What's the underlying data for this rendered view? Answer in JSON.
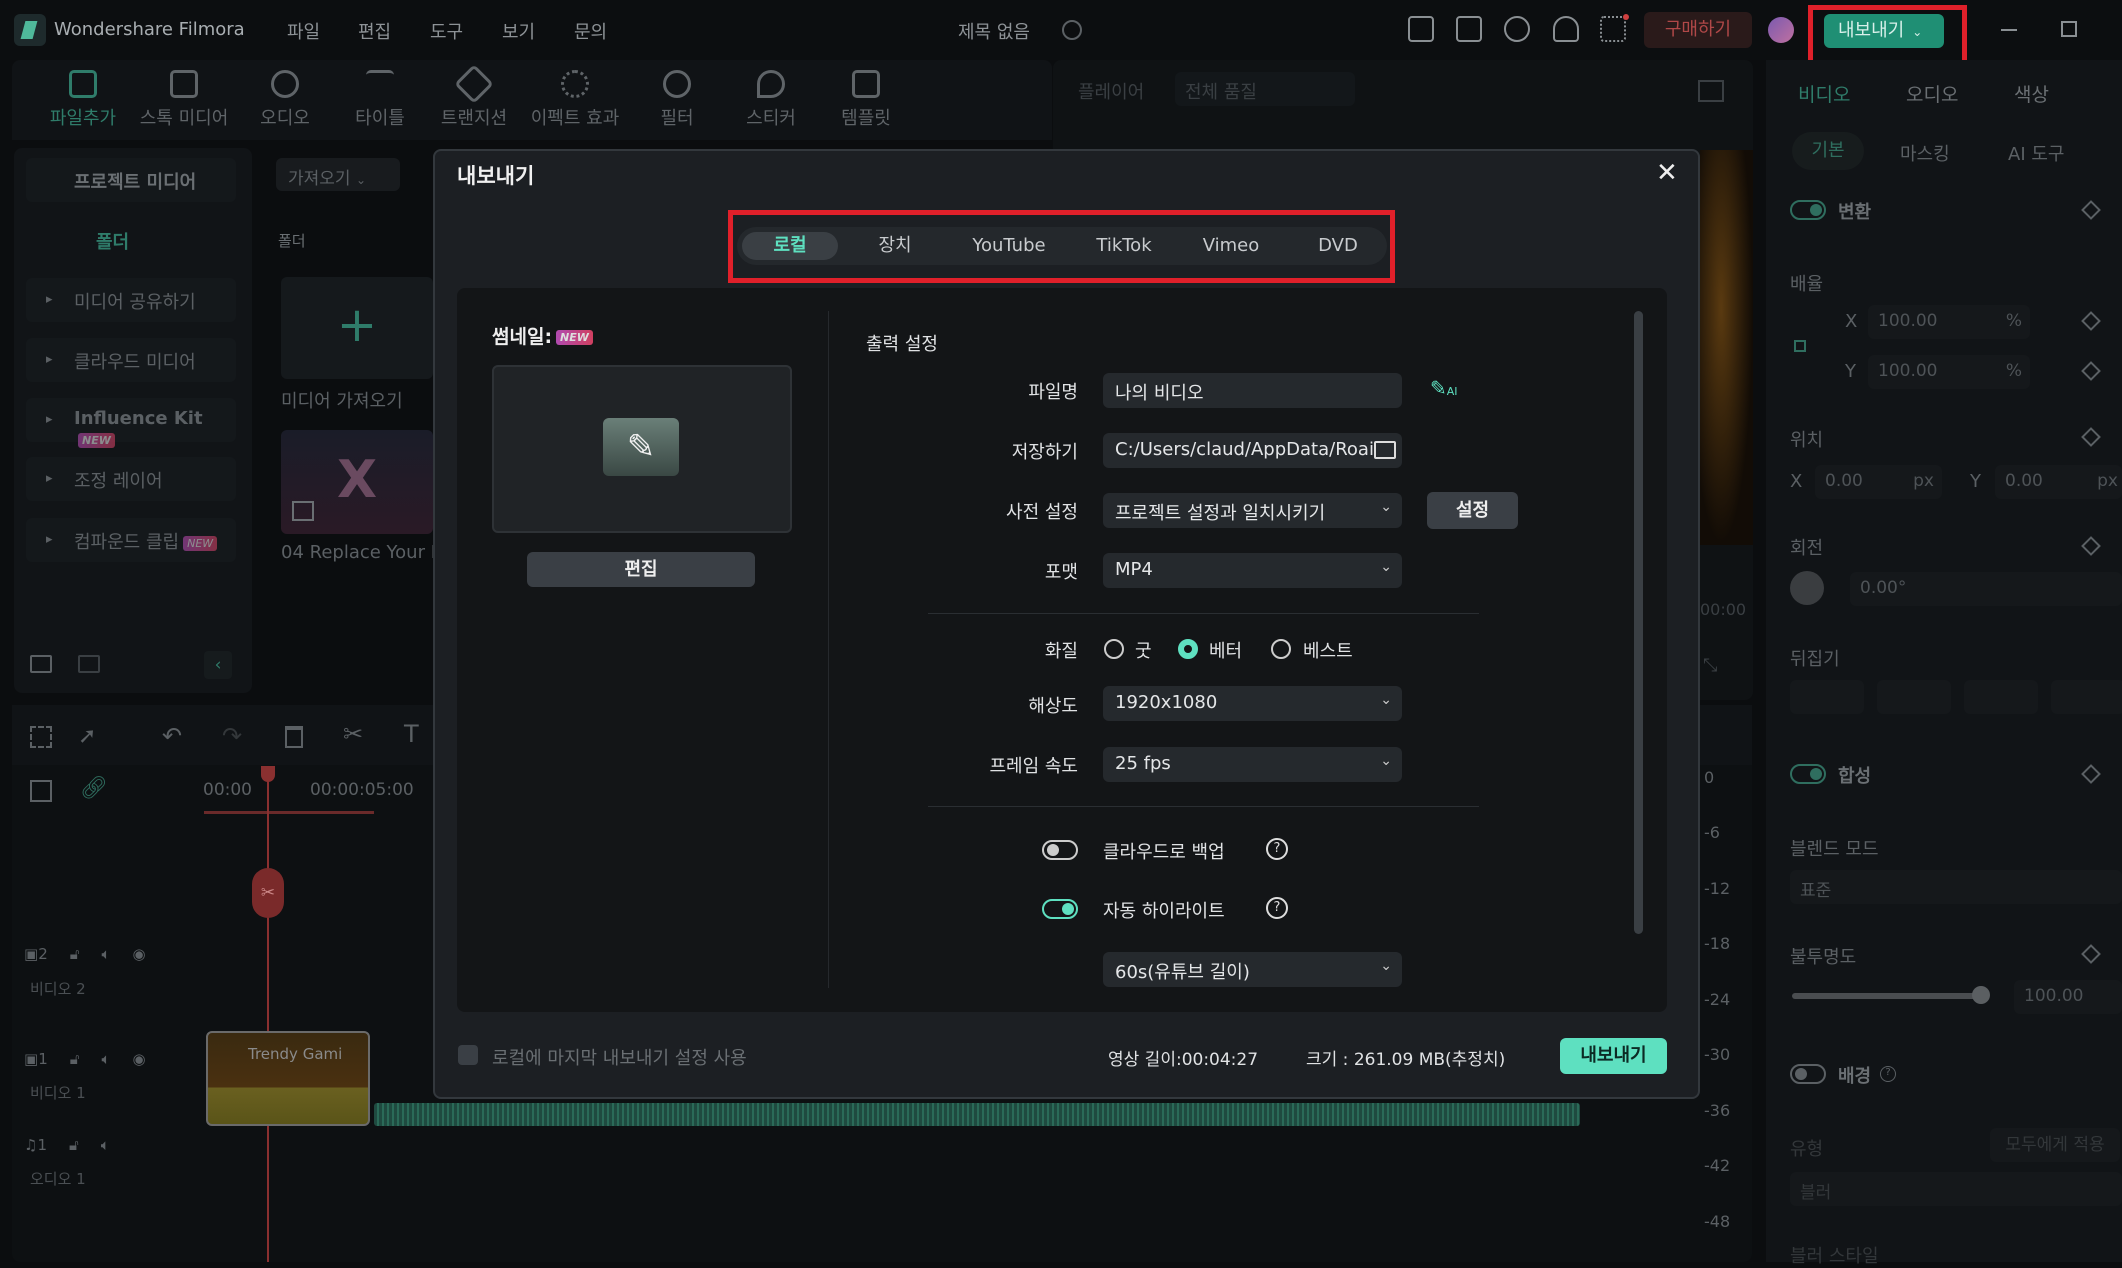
{
  "app": {
    "name": "Wondershare Filmora",
    "project_title": "제목 없음",
    "menu": [
      "파일",
      "편집",
      "도구",
      "보기",
      "문의"
    ],
    "buy_label": "구매하기",
    "export_label": "내보내기"
  },
  "toolbar": [
    "파일추가",
    "스톡 미디어",
    "오디오",
    "타이틀",
    "트랜지션",
    "이펙트 효과",
    "필터",
    "스티커",
    "템플릿"
  ],
  "left_panel": {
    "project_media": "프로젝트 미디어",
    "folder": "폴더",
    "items": [
      "미디어 공유하기",
      "클라우드 미디어",
      "Influence Kit",
      "조정 레이어",
      "컴파운드 클립"
    ],
    "new_badge": "NEW"
  },
  "media": {
    "import_dropdown": "가져오기",
    "folder_label": "폴더",
    "import_tile": "미디어 가져오기",
    "clip_name": "04 Replace Your P"
  },
  "player": {
    "label": "플레이어",
    "quality": "전체 품질",
    "time_fragment": "00:00"
  },
  "right_panel": {
    "tabs": [
      "비디오",
      "오디오",
      "색상"
    ],
    "subtabs": [
      "기본",
      "마스킹",
      "AI 도구"
    ],
    "transform": "변환",
    "scale": "배율",
    "scale_x": "100.00",
    "scale_y": "100.00",
    "percent": "%",
    "position": "위치",
    "pos_x": "0.00",
    "pos_y": "0.00",
    "px": "px",
    "rotation": "회전",
    "rotation_value": "0.00°",
    "flip": "뒤집기",
    "compositing": "합성",
    "blend_mode": "블렌드 모드",
    "blend_value": "표준",
    "opacity": "불투명도",
    "opacity_value": "100.00",
    "opacity_fraction": 1.0,
    "background": "배경",
    "type": "유형",
    "apply_all": "모두에게 적용",
    "blur": "블러",
    "blur_style": "블러 스타일",
    "x": "X",
    "y": "Y"
  },
  "timeline": {
    "ruler": [
      "00:00",
      "00:00:05:00"
    ],
    "tracks": [
      {
        "num": "2",
        "name": "비디오 2"
      },
      {
        "num": "1",
        "name": "비디오 1"
      },
      {
        "num": "1",
        "name": "오디오 1"
      }
    ],
    "clip_title": "Trendy Gami",
    "db_scale": [
      "0",
      "-6",
      "-12",
      "-18",
      "-24",
      "-30",
      "-36",
      "-42",
      "-48"
    ]
  },
  "dialog": {
    "title": "내보내기",
    "tabs": [
      "로컬",
      "장치",
      "YouTube",
      "TikTok",
      "Vimeo",
      "DVD"
    ],
    "active_tab": "로컬",
    "thumbnail_label": "썸네일:",
    "new_badge": "NEW",
    "edit_button": "편집",
    "output_settings": "출력 설정",
    "filename_label": "파일명",
    "filename": "나의 비디오",
    "save_label": "저장하기",
    "save_path": "C:/Users/claud/AppData/Roai",
    "preset_label": "사전 설정",
    "preset": "프로젝트 설정과 일치시키기",
    "preset_button": "설정",
    "format_label": "포맷",
    "format": "MP4",
    "quality_label": "화질",
    "quality_options": [
      "굿",
      "베터",
      "베스트"
    ],
    "quality_selected": "베터",
    "resolution_label": "해상도",
    "resolution": "1920x1080",
    "framerate_label": "프레임 속도",
    "framerate": "25 fps",
    "cloud_backup": "클라우드로 백업",
    "cloud_backup_on": false,
    "auto_highlight": "자동 하이라이트",
    "auto_highlight_on": true,
    "highlight_length": "60s(유튜브 길이)",
    "use_last_settings": "로컬에 마지막 내보내기 설정 사용",
    "duration": "영상 길이:00:04:27",
    "size": "크기 : 261.09 MB(추정치)",
    "export_button": "내보내기"
  },
  "colors": {
    "accent": "#5ee0c0",
    "highlight_box": "#e0202a",
    "export_btn_top": "#1f8f74"
  }
}
